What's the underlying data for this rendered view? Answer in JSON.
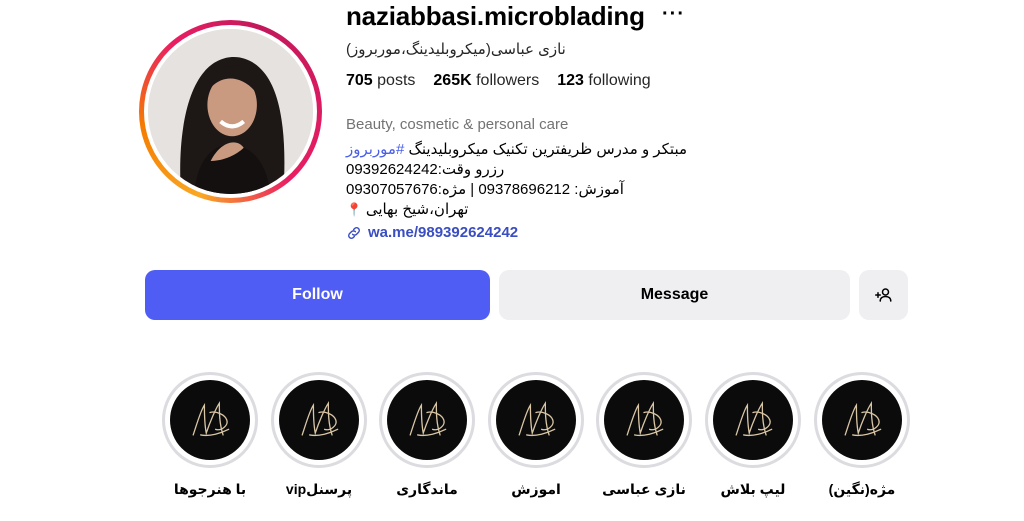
{
  "profile": {
    "username": "naziabbasi.microblading",
    "full_name": "نازی عباسی(میکروبلیدینگ،موربروز)",
    "more_icon": "ellipsis-icon",
    "stats": {
      "posts_value": "705",
      "posts_label": "posts",
      "followers_value": "265K",
      "followers_label": "followers",
      "following_value": "123",
      "following_label": "following"
    },
    "category": "Beauty, cosmetic & personal care",
    "bio": {
      "line1_text": "مبتکر و مدرس ظریفترین تکنیک میکروبلیدینگ ",
      "line1_hashtag": "#موربروز",
      "line2": "رزرو وقت:09392624242",
      "line3": "آموزش: 09378696212 | مژه:09307057676",
      "line4": "تهران،شیخ بهایی",
      "line4_icon": "pin-icon"
    },
    "link": {
      "text": "wa.me/989392624242",
      "icon": "link-icon"
    }
  },
  "actions": {
    "follow_label": "Follow",
    "message_label": "Message",
    "add_user_icon": "add-user-icon",
    "follow_color": "#4f5df5"
  },
  "highlights": [
    {
      "label": "با هنرجوها"
    },
    {
      "label": "پرسنلvip"
    },
    {
      "label": "ماندگاری"
    },
    {
      "label": "اموزش"
    },
    {
      "label": "نازی عباسی"
    },
    {
      "label": "لیپ بلاش"
    },
    {
      "label": "مژه(نگین)"
    }
  ]
}
